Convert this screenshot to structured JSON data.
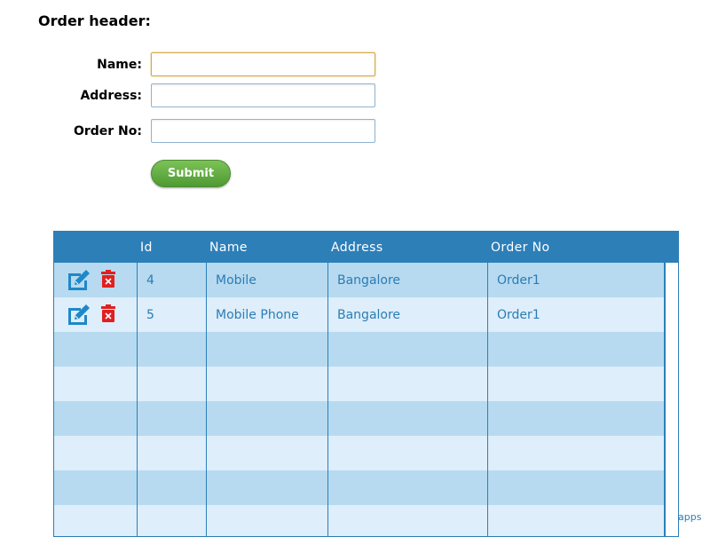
{
  "form": {
    "title": "Order header:",
    "name_label": "Name:",
    "name_value": "",
    "address_label": "Address:",
    "address_value": "",
    "order_no_label": "Order No:",
    "order_no_value": "",
    "submit_label": "Submit"
  },
  "grid": {
    "columns": [
      "",
      "Id",
      "Name",
      "Address",
      "Order No"
    ],
    "rows": [
      {
        "id": "4",
        "name": "Mobile",
        "address": "Bangalore",
        "order_no": "Order1"
      },
      {
        "id": "5",
        "name": "Mobile Phone",
        "address": "Bangalore",
        "order_no": "Order1"
      }
    ],
    "empty_rows": 6
  },
  "footer": {
    "link_text": "apps"
  },
  "colors": {
    "header": "#2d7fb8",
    "row_odd": "#b7daf0",
    "row_even": "#deeefa",
    "cell_text": "#2b7cb5",
    "edit_icon": "#1e88c9",
    "delete_icon": "#e0201f",
    "submit": "#5aa63c"
  },
  "icons": {
    "edit": "edit-icon",
    "delete": "delete-icon"
  }
}
